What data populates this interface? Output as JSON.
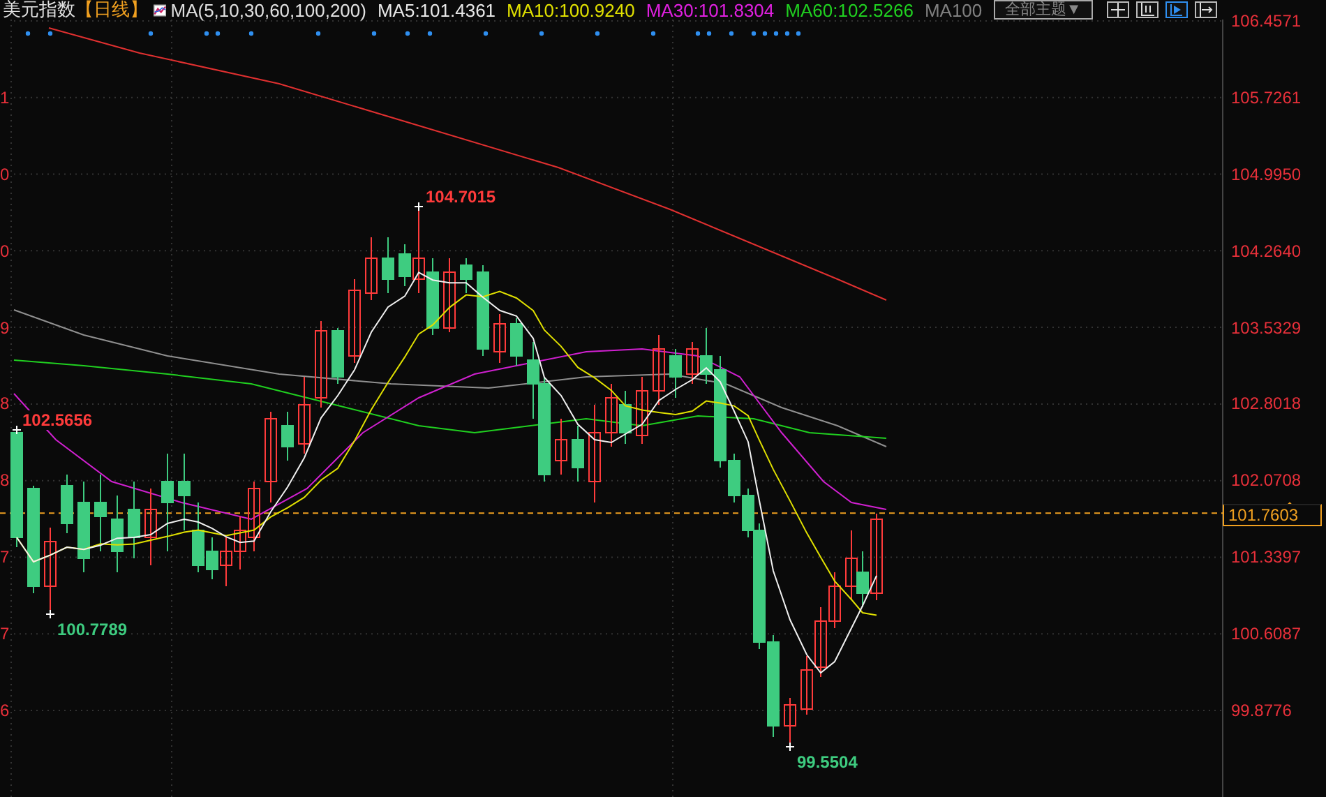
{
  "header": {
    "title": "美元指数",
    "period": "【日线】",
    "ma_params": "MA(5,10,30,60,100,200)",
    "ma_values": [
      {
        "label": "MA5:101.4361",
        "color": "#e8e8e8"
      },
      {
        "label": "MA10:100.9240",
        "color": "#e0e000"
      },
      {
        "label": "MA30:101.8304",
        "color": "#e020e0"
      },
      {
        "label": "MA60:102.5266",
        "color": "#20d020"
      },
      {
        "label": "MA100",
        "color": "#808080"
      }
    ],
    "theme_dropdown": "全部主题▼",
    "tools": [
      {
        "kind": "crosshair",
        "selected": false
      },
      {
        "kind": "range",
        "selected": false
      },
      {
        "kind": "play",
        "selected": true
      },
      {
        "kind": "expand",
        "selected": false
      }
    ]
  },
  "left_axis_fragments": [
    "1",
    "0",
    "0",
    "9",
    "8",
    "8",
    "7",
    "7",
    "6"
  ],
  "price_axis": {
    "ticks": [
      "106.4571",
      "105.7261",
      "104.9950",
      "104.2640",
      "103.5329",
      "102.8018",
      "102.0708",
      "101.3397",
      "100.6087",
      "99.8776"
    ],
    "current_price": "101.7603"
  },
  "annotations": [
    {
      "kind": "high",
      "label": "104.7015"
    },
    {
      "kind": "high",
      "label": "102.5656"
    },
    {
      "kind": "low",
      "label": "100.7789"
    },
    {
      "kind": "low",
      "label": "99.5504"
    }
  ]
}
